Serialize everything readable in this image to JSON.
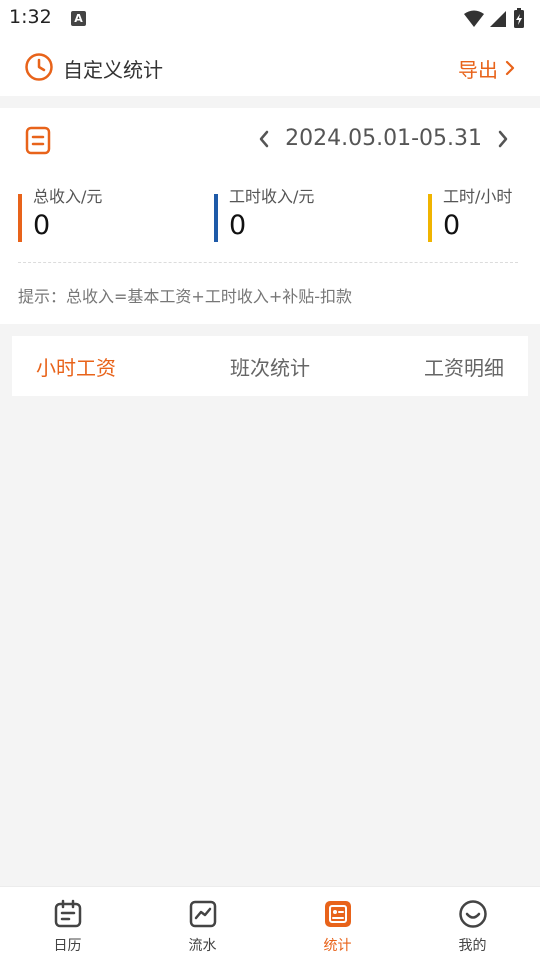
{
  "status_bar": {
    "time": "1:32",
    "notification_glyph": "A"
  },
  "header": {
    "title": "自定义统计",
    "export_label": "导出"
  },
  "stats": {
    "date_range": "2024.05.01-05.31",
    "metrics": [
      {
        "label": "总收入/元",
        "value": "0",
        "color": "#e8631a"
      },
      {
        "label": "工时收入/元",
        "value": "0",
        "color": "#1e5aa8"
      },
      {
        "label": "工时/小时",
        "value": "0",
        "color": "#f0b400"
      }
    ],
    "hint": "提示：总收入=基本工资+工时收入+补贴-扣款"
  },
  "tabs": [
    {
      "label": "小时工资",
      "active": true
    },
    {
      "label": "班次统计",
      "active": false
    },
    {
      "label": "工资明细",
      "active": false
    }
  ],
  "bottom_nav": [
    {
      "label": "日历",
      "icon": "calendar-icon",
      "active": false
    },
    {
      "label": "流水",
      "icon": "chart-icon",
      "active": false
    },
    {
      "label": "统计",
      "icon": "stats-icon",
      "active": true
    },
    {
      "label": "我的",
      "icon": "smile-icon",
      "active": false
    }
  ],
  "colors": {
    "accent": "#e8631a",
    "blue": "#1e5aa8",
    "yellow": "#f0b400"
  }
}
